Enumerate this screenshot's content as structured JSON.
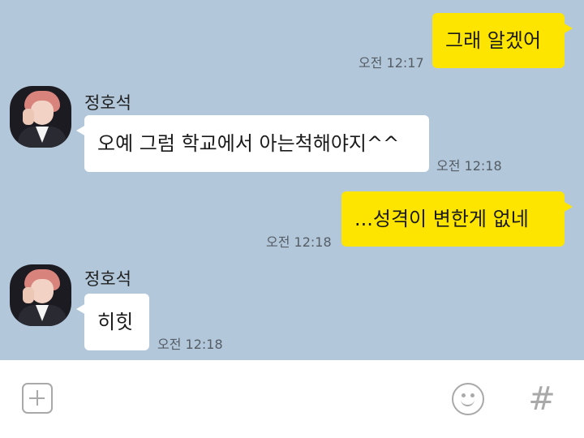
{
  "messages": [
    {
      "sender": "me",
      "text": "그래 알겠어",
      "time": "오전 12:17"
    },
    {
      "sender": "정호석",
      "text": "오예 그럼 학교에서 아는척해야지^^",
      "time": "오전 12:18"
    },
    {
      "sender": "me",
      "text": "...성격이 변한게 없네",
      "time": "오전 12:18"
    },
    {
      "sender": "정호석",
      "text": "히힛",
      "time": "오전 12:18"
    }
  ],
  "contact": {
    "name": "정호석"
  },
  "input_bar": {
    "plus_icon": "plus-square-icon",
    "emoji_icon": "emoji-icon",
    "hash_icon": "hash-icon",
    "hash_glyph": "#"
  },
  "colors": {
    "background": "#b2c7d9",
    "my_bubble": "#fee500",
    "other_bubble": "#ffffff",
    "icon": "#a9a9a9"
  }
}
